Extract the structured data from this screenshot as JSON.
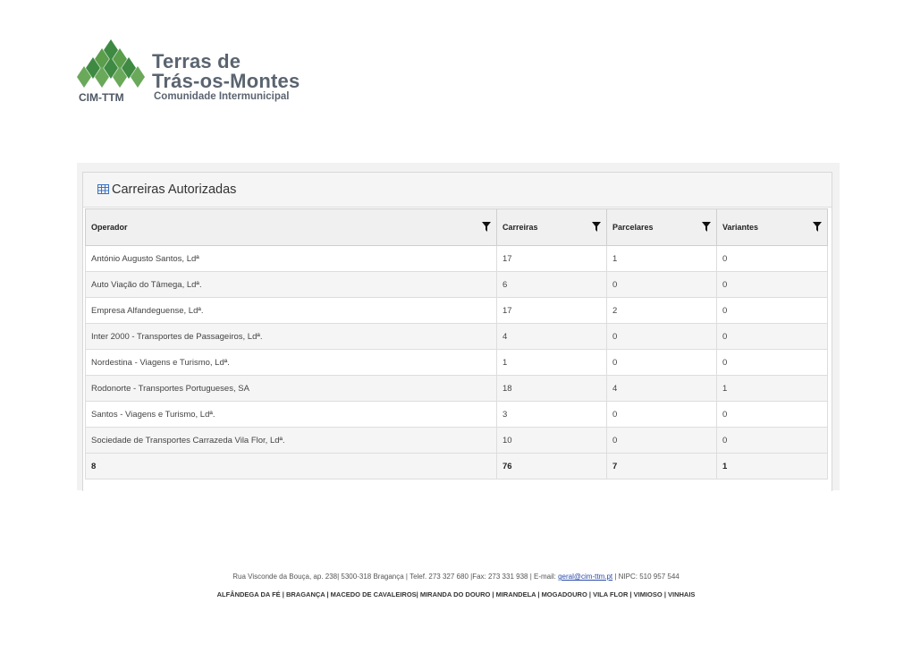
{
  "logo": {
    "title_line1": "Terras de",
    "title_line2": "Trás-os-Montes",
    "subtitle": "Comunidade Intermunicipal",
    "abbreviation": "CIM-TTM",
    "mark_icon": "green-diamond-mountains-logo",
    "brand_color": "#3f8a43"
  },
  "widget": {
    "title": "Carreiras Autorizadas",
    "title_icon": "table-grid-icon",
    "columns": [
      "Operador",
      "Carreiras",
      "Parcelares",
      "Variantes"
    ],
    "rows": [
      [
        "António Augusto Santos, Ldª",
        "17",
        "1",
        "0"
      ],
      [
        "Auto Viação do Tâmega, Ldª.",
        "6",
        "0",
        "0"
      ],
      [
        "Empresa Alfandeguense, Ldª.",
        "17",
        "2",
        "0"
      ],
      [
        "Inter 2000 - Transportes de Passageiros, Ldª.",
        "4",
        "0",
        "0"
      ],
      [
        "Nordestina - Viagens e Turismo, Ldª.",
        "1",
        "0",
        "0"
      ],
      [
        "Rodonorte - Transportes Portugueses, SA",
        "18",
        "4",
        "1"
      ],
      [
        "Santos - Viagens e Turismo, Ldª.",
        "3",
        "0",
        "0"
      ],
      [
        "Sociedade de Transportes Carrazeda Vila Flor, Ldª.",
        "10",
        "0",
        "0"
      ]
    ],
    "totals": [
      "8",
      "76",
      "7",
      "1"
    ]
  },
  "footer": {
    "address_before": "Rua Visconde da Bouça, ap. 238| 5300-318 Bragança | Telef. 273 327 680 |Fax: 273 331 938 | E-mail: ",
    "email": "geral@cim-ttm.pt",
    "address_after": " | NIPC: 510 957 544",
    "municipalities": "ALFÂNDEGA DA FÉ | BRAGANÇA | MACEDO DE CAVALEIROS| MIRANDA DO DOURO | MIRANDELA | MOGADOURO | VILA FLOR | VIMIOSO | VINHAIS"
  }
}
